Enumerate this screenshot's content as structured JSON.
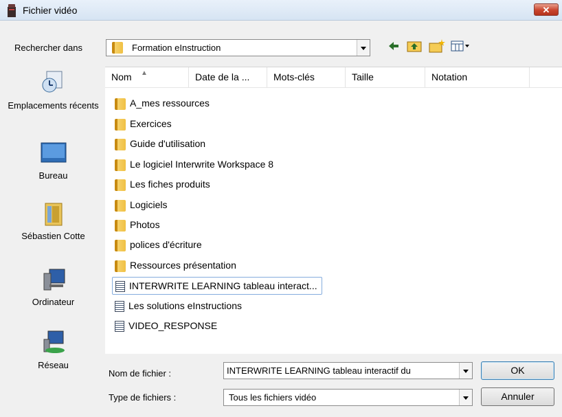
{
  "window": {
    "title": "Fichier vidéo",
    "close_label": "✕"
  },
  "lookin": {
    "label": "Rechercher dans",
    "value": "Formation eInstruction"
  },
  "toolbar": {
    "back_icon": "back-arrow-icon",
    "up_icon": "up-folder-icon",
    "new_folder_icon": "new-folder-icon",
    "view_icon": "view-menu-icon"
  },
  "places": [
    {
      "label": "Emplacements récents",
      "icon": "recent-places-icon"
    },
    {
      "label": "Bureau",
      "icon": "desktop-icon"
    },
    {
      "label": "Sébastien Cotte",
      "icon": "user-folder-icon"
    },
    {
      "label": "Ordinateur",
      "icon": "computer-icon"
    },
    {
      "label": "Réseau",
      "icon": "network-icon"
    }
  ],
  "columns": [
    "Nom",
    "Date de la ...",
    "Mots-clés",
    "Taille",
    "Notation"
  ],
  "files": [
    {
      "name": "A_mes ressources",
      "type": "folder"
    },
    {
      "name": "Exercices",
      "type": "folder"
    },
    {
      "name": "Guide d'utilisation",
      "type": "folder"
    },
    {
      "name": "Le logiciel Interwrite Workspace 8",
      "type": "folder"
    },
    {
      "name": "Les fiches produits",
      "type": "folder"
    },
    {
      "name": "Logiciels",
      "type": "folder"
    },
    {
      "name": "Photos",
      "type": "folder"
    },
    {
      "name": "polices d'écriture",
      "type": "folder"
    },
    {
      "name": "Ressources présentation",
      "type": "folder"
    },
    {
      "name": "INTERWRITE LEARNING tableau interact...",
      "type": "video",
      "selected": true
    },
    {
      "name": "Les solutions eInstructions",
      "type": "video"
    },
    {
      "name": "VIDEO_RESPONSE",
      "type": "video"
    }
  ],
  "filename": {
    "label": "Nom de fichier :",
    "value": "INTERWRITE LEARNING tableau interactif du"
  },
  "filetype": {
    "label": "Type de fichiers :",
    "value": "Tous les fichiers vidéo"
  },
  "buttons": {
    "ok": "OK",
    "cancel": "Annuler"
  }
}
